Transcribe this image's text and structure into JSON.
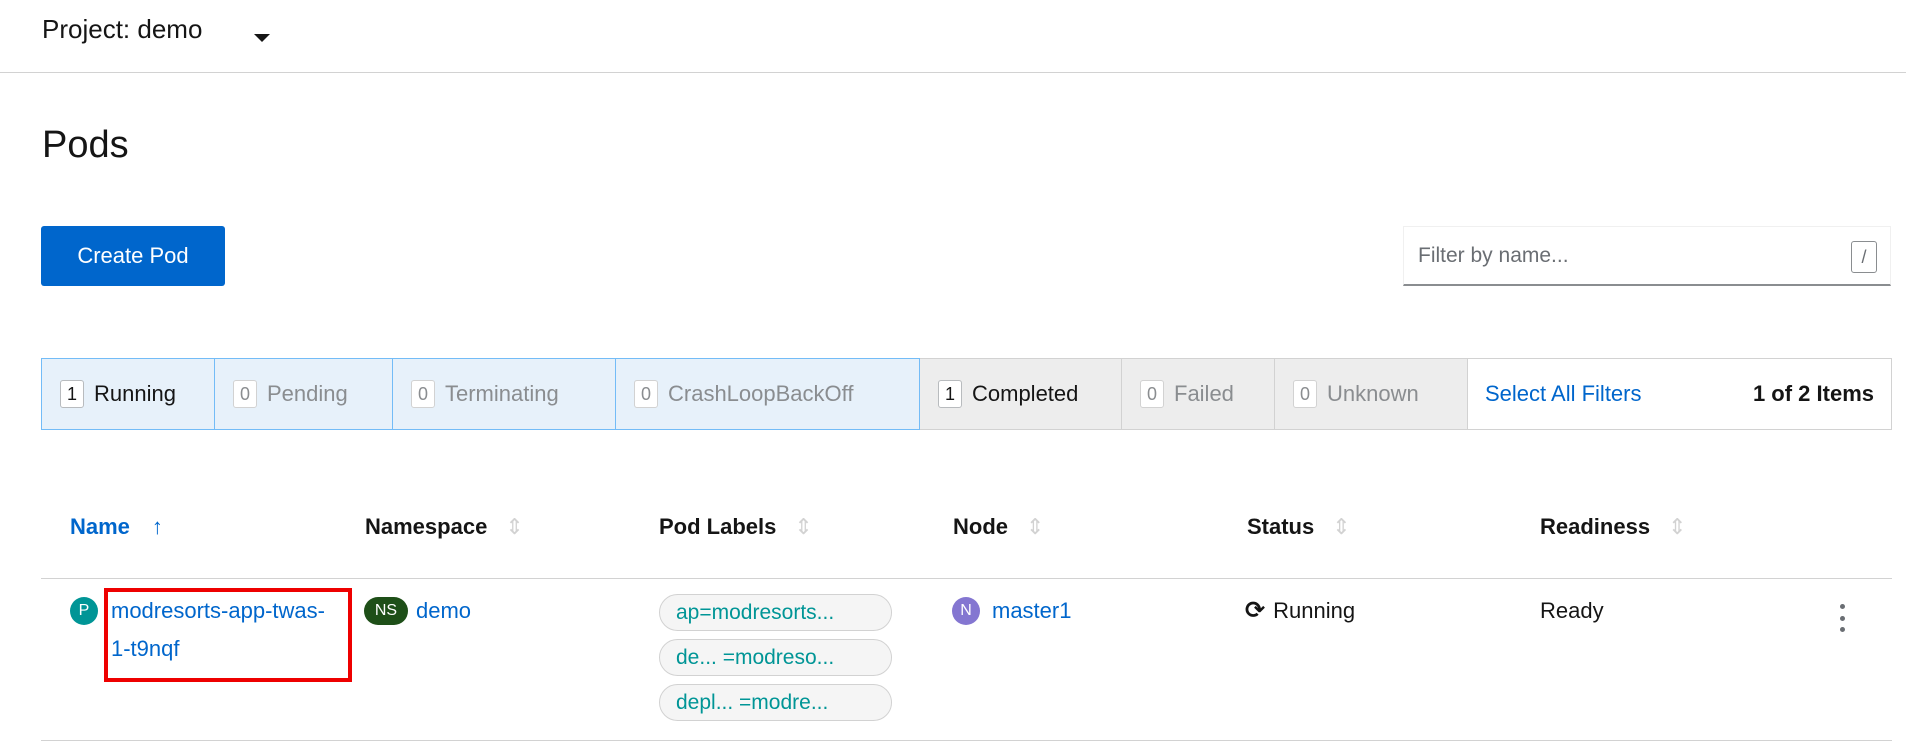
{
  "project": {
    "label": "Project: demo"
  },
  "page": {
    "title": "Pods"
  },
  "toolbar": {
    "create_label": "Create Pod",
    "filter_placeholder": "Filter by name...",
    "filter_shortcut": "/"
  },
  "status_filters": [
    {
      "count": "1",
      "label": "Running"
    },
    {
      "count": "0",
      "label": "Pending"
    },
    {
      "count": "0",
      "label": "Terminating"
    },
    {
      "count": "0",
      "label": "CrashLoopBackOff"
    },
    {
      "count": "1",
      "label": "Completed"
    },
    {
      "count": "0",
      "label": "Failed"
    },
    {
      "count": "0",
      "label": "Unknown"
    }
  ],
  "select_all_label": "Select All Filters",
  "item_count": "1 of 2 Items",
  "table": {
    "headers": {
      "name": "Name",
      "namespace": "Namespace",
      "pod_labels": "Pod Labels",
      "node": "Node",
      "status": "Status",
      "readiness": "Readiness"
    },
    "sort_active_icon": "↑",
    "sort_inactive_icon": "⇕",
    "rows": [
      {
        "pod_badge": "P",
        "name": "modresorts-app-twas-1-t9nqf",
        "namespace_badge": "NS",
        "namespace": "demo",
        "labels": [
          "ap=modresorts...",
          "de... =modreso...",
          "depl... =modre..."
        ],
        "node_badge": "N",
        "node": "master1",
        "status": "Running",
        "readiness": "Ready"
      }
    ]
  },
  "icons": {
    "project_dropdown": "caret-down-icon",
    "status": "sync-icon",
    "row_actions": "kebab-icon"
  },
  "colors": {
    "primary": "#0066cc",
    "active_filter_bg": "#e7f1fa",
    "pod_badge": "#009596",
    "namespace_badge": "#1e4f18",
    "node_badge": "#8476d1",
    "highlight": "#ee0000"
  }
}
